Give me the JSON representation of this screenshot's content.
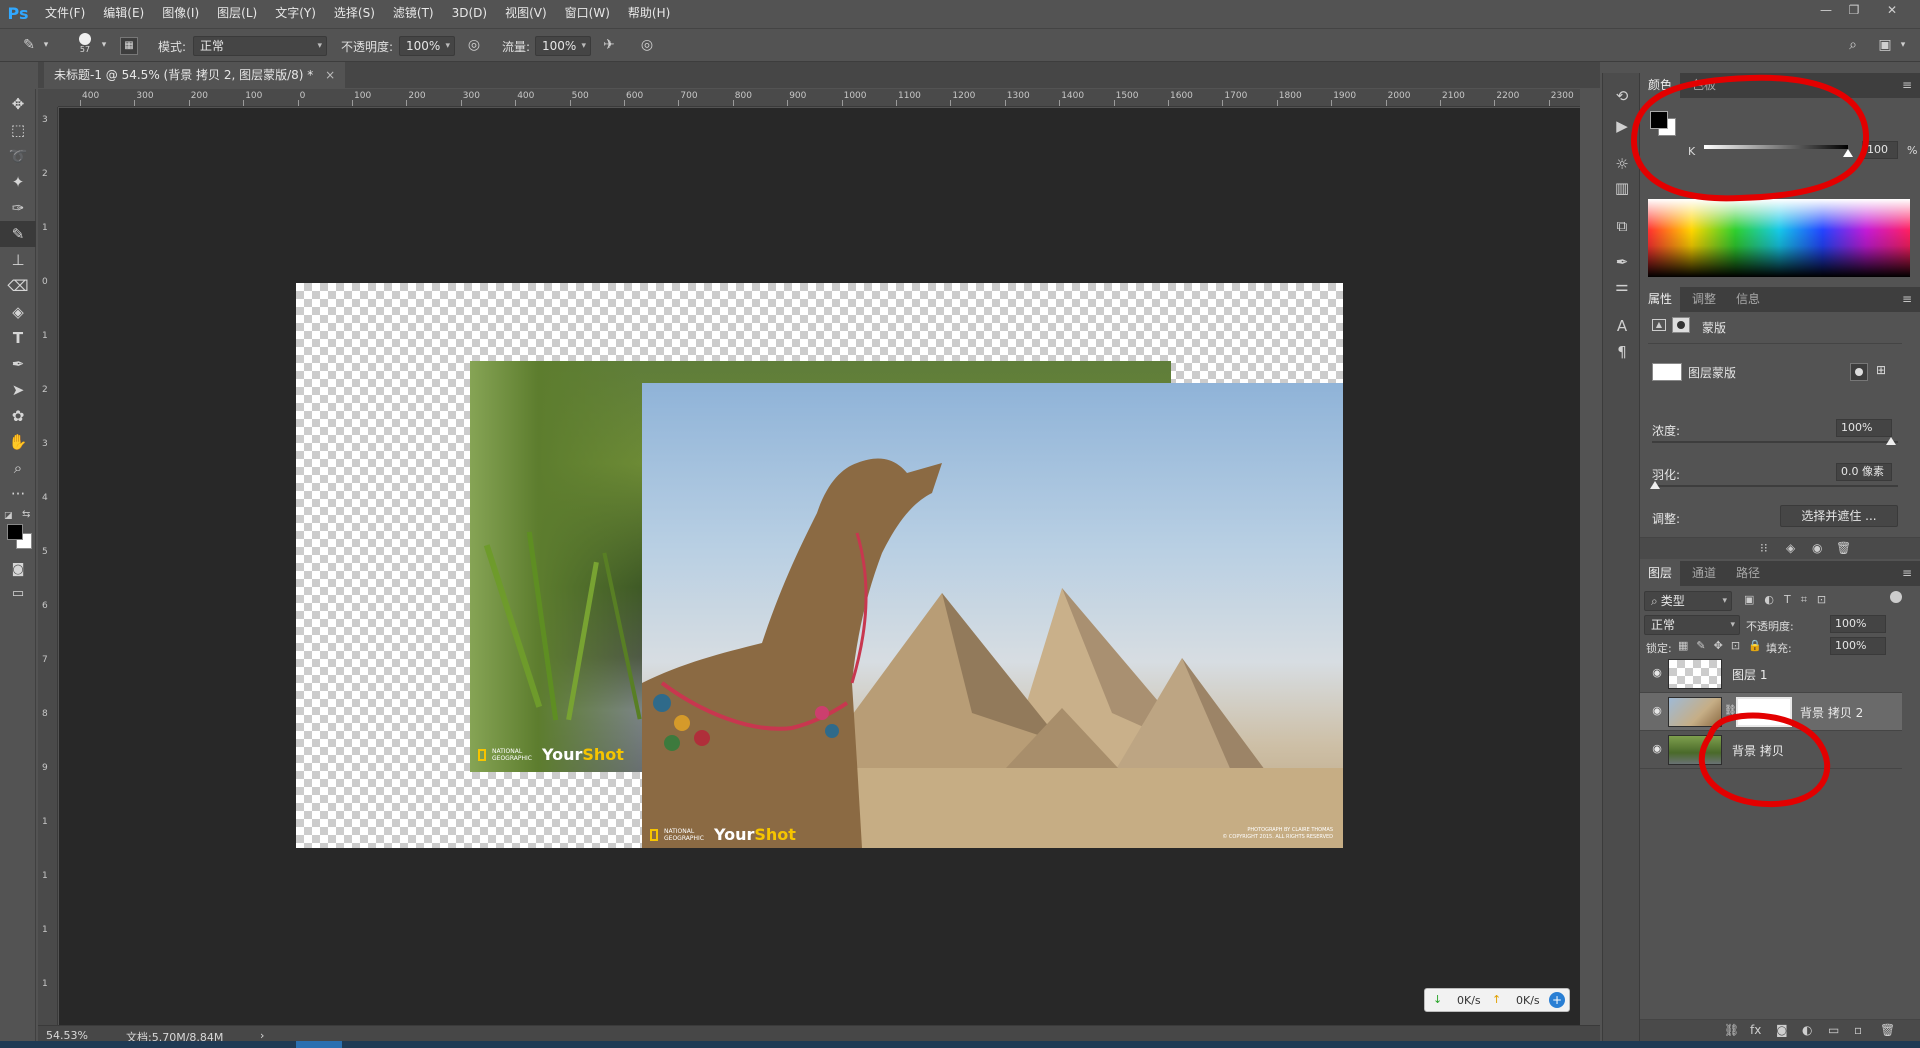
{
  "app": {
    "logo": "Ps"
  },
  "menu": [
    "文件(F)",
    "编辑(E)",
    "图像(I)",
    "图层(L)",
    "文字(Y)",
    "选择(S)",
    "滤镜(T)",
    "3D(D)",
    "视图(V)",
    "窗口(W)",
    "帮助(H)"
  ],
  "window_controls": {
    "minimize": "—",
    "restore": "❐",
    "close": "✕"
  },
  "options": {
    "brush_size": "57",
    "mode_label": "模式:",
    "mode_value": "正常",
    "opacity_label": "不透明度:",
    "opacity_value": "100%",
    "flow_label": "流量:",
    "flow_value": "100%"
  },
  "document_tab": {
    "title": "未标题-1 @ 54.5% (背景 拷贝 2, 图层蒙版/8) *",
    "close": "×"
  },
  "ruler_h_labels": [
    "400",
    "300",
    "200",
    "100",
    "0",
    "100",
    "200",
    "300",
    "400",
    "500",
    "600",
    "700",
    "800",
    "900",
    "1000",
    "1100",
    "1200",
    "1300",
    "1400",
    "1500",
    "1600",
    "1700",
    "1800",
    "1900",
    "2000",
    "2100",
    "2200",
    "2300"
  ],
  "ruler_v_labels": [
    "3",
    "2",
    "1",
    "0",
    "1",
    "2",
    "3",
    "4",
    "5",
    "6",
    "7",
    "8",
    "9",
    "1",
    "1",
    "1",
    "1"
  ],
  "canvas": {
    "photo1_brand": "NATIONAL GEOGRAPHIC",
    "photo1_caption_a": "Your ",
    "photo1_caption_b": "Shot",
    "photo2_brand": "NATIONAL GEOGRAPHIC",
    "photo2_caption_a": "Your ",
    "photo2_caption_b": "Shot",
    "photo2_credit_1": "PHOTOGRAPH BY CLAIRE THOMAS",
    "photo2_credit_2": "© COPYRIGHT 2015. ALL RIGHTS RESERVED"
  },
  "status": {
    "zoom": "54.53%",
    "doc": "文档:5.70M/8.84M",
    "arrow": "›"
  },
  "network": {
    "down": "0K/s",
    "up": "0K/s"
  },
  "color_panel": {
    "tabs": [
      "颜色",
      "色板"
    ],
    "channel_label": "K",
    "k_value": "100",
    "k_percent": 1.0,
    "unit": "%"
  },
  "properties_panel": {
    "tabs": [
      "属性",
      "调整",
      "信息"
    ],
    "mask_type": "蒙版",
    "mask_name": "图层蒙版",
    "density_label": "浓度:",
    "density_value": "100%",
    "feather_label": "羽化:",
    "feather_value": "0.0 像素",
    "adjust_label": "调整:",
    "select_mask_button": "选择并遮住 ..."
  },
  "layers_panel": {
    "tabs": [
      "图层",
      "通道",
      "路径"
    ],
    "filter_label": "类型",
    "blend_mode": "正常",
    "opacity_label": "不透明度:",
    "opacity_value": "100%",
    "lock_label": "锁定:",
    "fill_label": "填充:",
    "fill_value": "100%",
    "layers": [
      {
        "name": "图层 1",
        "visible": true,
        "selected": false
      },
      {
        "name": "背景 拷贝 2",
        "visible": true,
        "selected": true
      },
      {
        "name": "背景 拷贝",
        "visible": true,
        "selected": false
      }
    ],
    "footer_icons": [
      "link-icon",
      "fx-icon",
      "mask-icon",
      "adjustment-icon",
      "group-icon",
      "new-layer-icon",
      "trash-icon"
    ],
    "footer_glyphs": [
      "⛓",
      "fx",
      "◙",
      "◐",
      "▭",
      "▫",
      "🗑"
    ]
  },
  "colors": {
    "accent": "#31a8ff",
    "annotation": "#e30000",
    "selected_row": "#6a6a6a"
  }
}
